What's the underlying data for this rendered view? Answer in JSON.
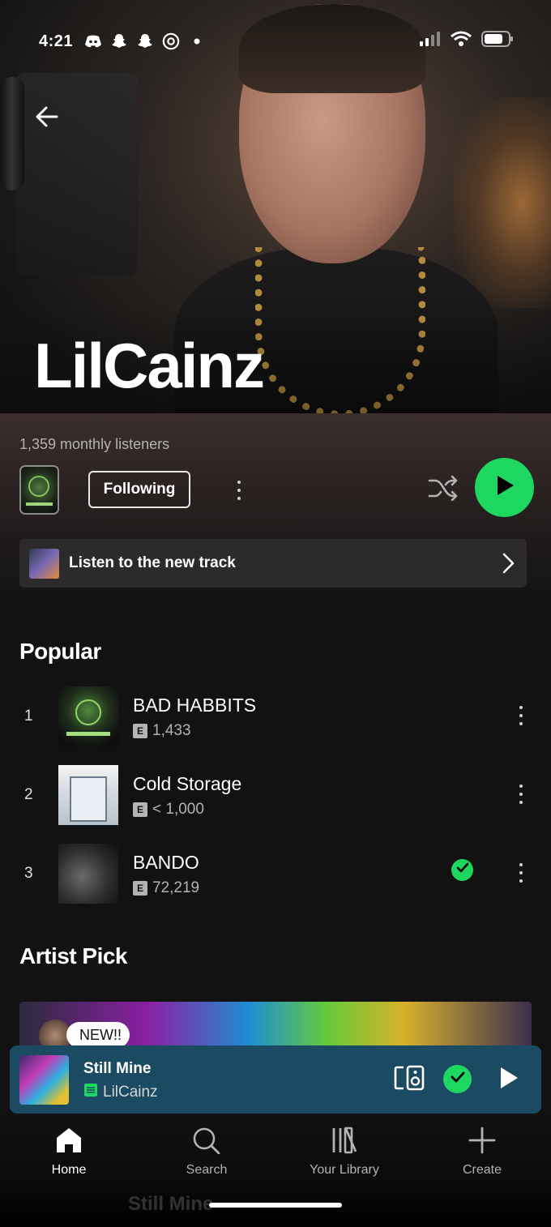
{
  "status_bar": {
    "time": "4:21"
  },
  "artist": {
    "name": "LilCainz",
    "monthly_listeners": "1,359 monthly listeners",
    "follow_label": "Following"
  },
  "new_track_banner": {
    "label": "Listen to the new track"
  },
  "popular": {
    "heading": "Popular",
    "tracks": [
      {
        "rank": "1",
        "title": "BAD HABBITS",
        "explicit": "E",
        "plays": "1,433",
        "saved": false
      },
      {
        "rank": "2",
        "title": "Cold Storage",
        "explicit": "E",
        "plays": "< 1,000",
        "saved": false
      },
      {
        "rank": "3",
        "title": "BANDO",
        "explicit": "E",
        "plays": "72,219",
        "saved": true
      }
    ]
  },
  "artist_pick": {
    "heading": "Artist Pick",
    "badge": "NEW!!"
  },
  "now_playing": {
    "title": "Still Mine",
    "artist": "LilCainz"
  },
  "bottom_nav": {
    "items": [
      {
        "label": "Home",
        "icon": "home-icon",
        "active": true
      },
      {
        "label": "Search",
        "icon": "search-icon",
        "active": false
      },
      {
        "label": "Your Library",
        "icon": "library-icon",
        "active": false
      },
      {
        "label": "Create",
        "icon": "plus-icon",
        "active": false
      }
    ]
  },
  "colors": {
    "accent": "#1ed760",
    "mini_player_bg": "#1b4b63",
    "background": "#121212"
  }
}
